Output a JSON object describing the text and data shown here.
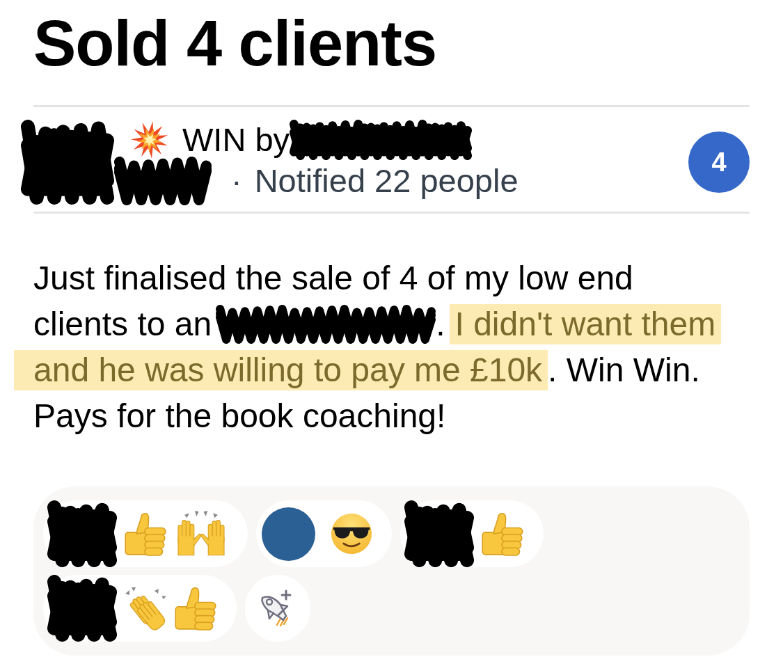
{
  "title": "Sold 4 clients",
  "header": {
    "label": "WIN by",
    "separator": "·",
    "notified": "Notified 22 people",
    "count": "4"
  },
  "post": {
    "lines": [
      {
        "runs": [
          {
            "kind": "text",
            "text": "Just finalised the sale of 4 of my low end",
            "highlighted": false
          }
        ]
      },
      {
        "runs": [
          {
            "kind": "text",
            "text": "clients to an",
            "highlighted": false
          },
          {
            "kind": "redacted"
          },
          {
            "kind": "text",
            "text": ".",
            "highlighted": false
          },
          {
            "kind": "text",
            "text": "I didn't want them",
            "highlighted": true
          }
        ]
      },
      {
        "runs": [
          {
            "kind": "text",
            "text": "and he was willing to pay me £10k",
            "highlighted": true
          },
          {
            "kind": "text",
            "text": ". Win Win.",
            "highlighted": false
          }
        ]
      },
      {
        "runs": [
          {
            "kind": "text",
            "text": "Pays for the book coaching!",
            "highlighted": false
          }
        ]
      }
    ]
  },
  "reactions": {
    "groups": [
      {
        "avatar": {
          "kind": "redacted"
        },
        "emojis": [
          {
            "kind": "thumbs_up"
          },
          {
            "kind": "raised_hands"
          }
        ]
      },
      {
        "avatar": {
          "kind": "plain"
        },
        "emojis": [
          {
            "kind": "sunglasses"
          }
        ]
      },
      {
        "avatar": {
          "kind": "redacted"
        },
        "emojis": [
          {
            "kind": "thumbs_up"
          }
        ]
      },
      {
        "avatar": {
          "kind": "redacted"
        },
        "emojis": [
          {
            "kind": "clapping"
          },
          {
            "kind": "thumbs_up"
          }
        ]
      }
    ],
    "add_button": true
  }
}
